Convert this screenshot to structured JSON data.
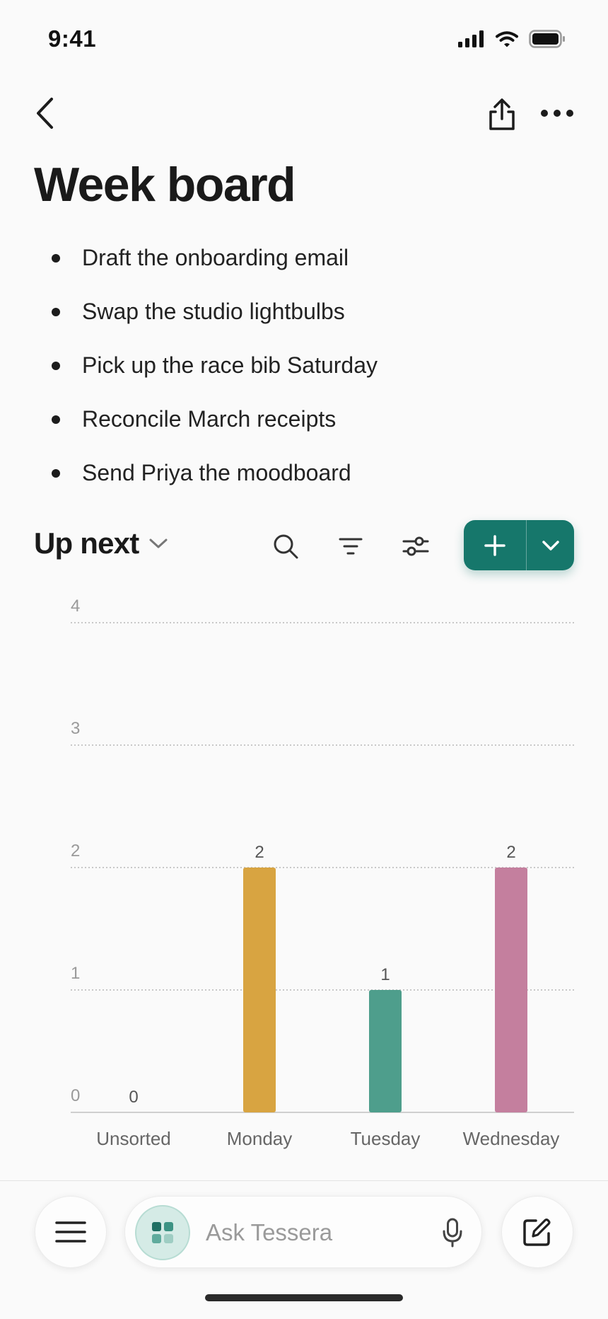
{
  "status_bar": {
    "time": "9:41"
  },
  "nav": {},
  "page": {
    "title": "Week board"
  },
  "tasks": [
    {
      "label": "Draft the onboarding email"
    },
    {
      "label": "Swap the studio lightbulbs"
    },
    {
      "label": "Pick up the race bib Saturday"
    },
    {
      "label": "Reconcile March receipts"
    },
    {
      "label": "Send Priya the moodboard"
    }
  ],
  "section": {
    "title": "Up next"
  },
  "chart_data": {
    "type": "bar",
    "categories": [
      "Unsorted",
      "Monday",
      "Tuesday",
      "Wednesday"
    ],
    "values": [
      0,
      2,
      1,
      2
    ],
    "colors": [
      "#9e9e9e",
      "#d8a441",
      "#4e9e8c",
      "#c47f9e"
    ],
    "ylim": [
      0,
      4
    ],
    "yticks": [
      0,
      1,
      2,
      3,
      4
    ],
    "grid": true,
    "data_labels": true
  },
  "composer": {
    "placeholder": "Ask Tessera"
  },
  "colors": {
    "accent": "#16776b",
    "background": "#fafafa"
  }
}
